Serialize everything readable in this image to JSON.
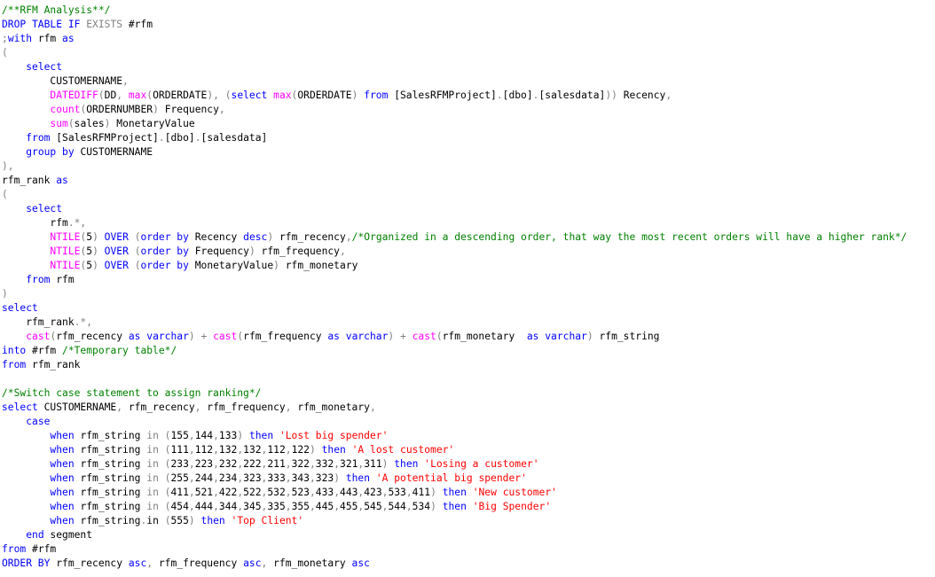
{
  "editor": {
    "language": "T-SQL",
    "colors": {
      "keyword": "#0000ff",
      "function": "#ff00ff",
      "comment": "#008000",
      "string": "#ff0000",
      "operator": "#808080",
      "text": "#000000"
    },
    "lines": [
      [
        [
          "c",
          "/**RFM Analysis**/"
        ]
      ],
      [
        [
          "k",
          "DROP TABLE IF "
        ],
        [
          "o",
          "EXISTS"
        ],
        [
          "t",
          " #rfm"
        ]
      ],
      [
        [
          "o",
          ";"
        ],
        [
          "k",
          "with"
        ],
        [
          "t",
          " rfm "
        ],
        [
          "k",
          "as"
        ]
      ],
      [
        [
          "o",
          "("
        ]
      ],
      [
        [
          "t",
          "    "
        ],
        [
          "k",
          "select"
        ]
      ],
      [
        [
          "t",
          "        CUSTOMERNAME"
        ],
        [
          "o",
          ","
        ]
      ],
      [
        [
          "t",
          "        "
        ],
        [
          "f",
          "DATEDIFF"
        ],
        [
          "o",
          "("
        ],
        [
          "t",
          "DD"
        ],
        [
          "o",
          ", "
        ],
        [
          "f",
          "max"
        ],
        [
          "o",
          "("
        ],
        [
          "t",
          "ORDERDATE"
        ],
        [
          "o",
          "), ("
        ],
        [
          "k",
          "select "
        ],
        [
          "f",
          "max"
        ],
        [
          "o",
          "("
        ],
        [
          "t",
          "ORDERDATE"
        ],
        [
          "o",
          ") "
        ],
        [
          "k",
          "from"
        ],
        [
          "t",
          " [SalesRFMProject]"
        ],
        [
          "o",
          "."
        ],
        [
          "t",
          "[dbo]"
        ],
        [
          "o",
          "."
        ],
        [
          "t",
          "[salesdata]"
        ],
        [
          "o",
          "))"
        ],
        [
          "t",
          " Recency"
        ],
        [
          "o",
          ","
        ]
      ],
      [
        [
          "t",
          "        "
        ],
        [
          "f",
          "count"
        ],
        [
          "o",
          "("
        ],
        [
          "t",
          "ORDERNUMBER"
        ],
        [
          "o",
          ")"
        ],
        [
          "t",
          " Frequency"
        ],
        [
          "o",
          ","
        ]
      ],
      [
        [
          "t",
          "        "
        ],
        [
          "f",
          "sum"
        ],
        [
          "o",
          "("
        ],
        [
          "t",
          "sales"
        ],
        [
          "o",
          ")"
        ],
        [
          "t",
          " MonetaryValue"
        ]
      ],
      [
        [
          "t",
          "    "
        ],
        [
          "k",
          "from"
        ],
        [
          "t",
          " [SalesRFMProject]"
        ],
        [
          "o",
          "."
        ],
        [
          "t",
          "[dbo]"
        ],
        [
          "o",
          "."
        ],
        [
          "t",
          "[salesdata]"
        ]
      ],
      [
        [
          "t",
          "    "
        ],
        [
          "k",
          "group by"
        ],
        [
          "t",
          " CUSTOMERNAME"
        ]
      ],
      [
        [
          "o",
          "),"
        ]
      ],
      [
        [
          "t",
          "rfm_rank "
        ],
        [
          "k",
          "as"
        ]
      ],
      [
        [
          "o",
          "("
        ]
      ],
      [
        [
          "t",
          "    "
        ],
        [
          "k",
          "select"
        ]
      ],
      [
        [
          "t",
          "        rfm"
        ],
        [
          "o",
          ".*,"
        ]
      ],
      [
        [
          "t",
          "        "
        ],
        [
          "f",
          "NTILE"
        ],
        [
          "o",
          "("
        ],
        [
          "t",
          "5"
        ],
        [
          "o",
          ") "
        ],
        [
          "k",
          "OVER"
        ],
        [
          "o",
          " ("
        ],
        [
          "k",
          "order by"
        ],
        [
          "t",
          " Recency "
        ],
        [
          "k",
          "desc"
        ],
        [
          "o",
          ")"
        ],
        [
          "t",
          " rfm_recency"
        ],
        [
          "o",
          ","
        ],
        [
          "c",
          "/*Organized in a descending order, that way the most recent orders will have a higher rank*/"
        ]
      ],
      [
        [
          "t",
          "        "
        ],
        [
          "f",
          "NTILE"
        ],
        [
          "o",
          "("
        ],
        [
          "t",
          "5"
        ],
        [
          "o",
          ") "
        ],
        [
          "k",
          "OVER"
        ],
        [
          "o",
          " ("
        ],
        [
          "k",
          "order by"
        ],
        [
          "t",
          " Frequency"
        ],
        [
          "o",
          ")"
        ],
        [
          "t",
          " rfm_frequency"
        ],
        [
          "o",
          ","
        ]
      ],
      [
        [
          "t",
          "        "
        ],
        [
          "f",
          "NTILE"
        ],
        [
          "o",
          "("
        ],
        [
          "t",
          "5"
        ],
        [
          "o",
          ") "
        ],
        [
          "k",
          "OVER"
        ],
        [
          "o",
          " ("
        ],
        [
          "k",
          "order by"
        ],
        [
          "t",
          " MonetaryValue"
        ],
        [
          "o",
          ")"
        ],
        [
          "t",
          " rfm_monetary"
        ]
      ],
      [
        [
          "t",
          "    "
        ],
        [
          "k",
          "from"
        ],
        [
          "t",
          " rfm"
        ]
      ],
      [
        [
          "o",
          ")"
        ]
      ],
      [
        [
          "k",
          "select"
        ]
      ],
      [
        [
          "t",
          "    rfm_rank"
        ],
        [
          "o",
          ".*,"
        ]
      ],
      [
        [
          "t",
          "    "
        ],
        [
          "f",
          "cast"
        ],
        [
          "o",
          "("
        ],
        [
          "t",
          "rfm_recency "
        ],
        [
          "k",
          "as varchar"
        ],
        [
          "o",
          ") + "
        ],
        [
          "f",
          "cast"
        ],
        [
          "o",
          "("
        ],
        [
          "t",
          "rfm_frequency "
        ],
        [
          "k",
          "as varchar"
        ],
        [
          "o",
          ") + "
        ],
        [
          "f",
          "cast"
        ],
        [
          "o",
          "("
        ],
        [
          "t",
          "rfm_monetary  "
        ],
        [
          "k",
          "as varchar"
        ],
        [
          "o",
          ")"
        ],
        [
          "t",
          " rfm_string"
        ]
      ],
      [
        [
          "k",
          "into"
        ],
        [
          "t",
          " #rfm "
        ],
        [
          "c",
          "/*Temporary table*/"
        ]
      ],
      [
        [
          "k",
          "from"
        ],
        [
          "t",
          " rfm_rank"
        ]
      ],
      [],
      [
        [
          "c",
          "/*Switch case statement to assign ranking*/"
        ]
      ],
      [
        [
          "k",
          "select"
        ],
        [
          "t",
          " CUSTOMERNAME"
        ],
        [
          "o",
          ","
        ],
        [
          "t",
          " rfm_recency"
        ],
        [
          "o",
          ","
        ],
        [
          "t",
          " rfm_frequency"
        ],
        [
          "o",
          ","
        ],
        [
          "t",
          " rfm_monetary"
        ],
        [
          "o",
          ","
        ]
      ],
      [
        [
          "t",
          "    "
        ],
        [
          "k",
          "case"
        ]
      ],
      [
        [
          "t",
          "        "
        ],
        [
          "k",
          "when"
        ],
        [
          "t",
          " rfm_string "
        ],
        [
          "o",
          "in ("
        ],
        [
          "t",
          "155"
        ],
        [
          "o",
          ","
        ],
        [
          "t",
          "144"
        ],
        [
          "o",
          ","
        ],
        [
          "t",
          "133"
        ],
        [
          "o",
          ") "
        ],
        [
          "k",
          "then "
        ],
        [
          "s",
          "'Lost big spender'"
        ]
      ],
      [
        [
          "t",
          "        "
        ],
        [
          "k",
          "when"
        ],
        [
          "t",
          " rfm_string "
        ],
        [
          "o",
          "in ("
        ],
        [
          "t",
          "111"
        ],
        [
          "o",
          ","
        ],
        [
          "t",
          "112"
        ],
        [
          "o",
          ","
        ],
        [
          "t",
          "132"
        ],
        [
          "o",
          ","
        ],
        [
          "t",
          "132"
        ],
        [
          "o",
          ","
        ],
        [
          "t",
          "112"
        ],
        [
          "o",
          ","
        ],
        [
          "t",
          "122"
        ],
        [
          "o",
          ") "
        ],
        [
          "k",
          "then "
        ],
        [
          "s",
          "'A lost customer'"
        ]
      ],
      [
        [
          "t",
          "        "
        ],
        [
          "k",
          "when"
        ],
        [
          "t",
          " rfm_string "
        ],
        [
          "o",
          "in ("
        ],
        [
          "t",
          "233"
        ],
        [
          "o",
          ","
        ],
        [
          "t",
          "223"
        ],
        [
          "o",
          ","
        ],
        [
          "t",
          "232"
        ],
        [
          "o",
          ","
        ],
        [
          "t",
          "222"
        ],
        [
          "o",
          ","
        ],
        [
          "t",
          "211"
        ],
        [
          "o",
          ","
        ],
        [
          "t",
          "322"
        ],
        [
          "o",
          ","
        ],
        [
          "t",
          "332"
        ],
        [
          "o",
          ","
        ],
        [
          "t",
          "321"
        ],
        [
          "o",
          ","
        ],
        [
          "t",
          "311"
        ],
        [
          "o",
          ") "
        ],
        [
          "k",
          "then "
        ],
        [
          "s",
          "'Losing a customer'"
        ]
      ],
      [
        [
          "t",
          "        "
        ],
        [
          "k",
          "when"
        ],
        [
          "t",
          " rfm_string "
        ],
        [
          "o",
          "in ("
        ],
        [
          "t",
          "255"
        ],
        [
          "o",
          ","
        ],
        [
          "t",
          "244"
        ],
        [
          "o",
          ","
        ],
        [
          "t",
          "234"
        ],
        [
          "o",
          ","
        ],
        [
          "t",
          "323"
        ],
        [
          "o",
          ","
        ],
        [
          "t",
          "333"
        ],
        [
          "o",
          ","
        ],
        [
          "t",
          "343"
        ],
        [
          "o",
          ","
        ],
        [
          "t",
          "323"
        ],
        [
          "o",
          ") "
        ],
        [
          "k",
          "then "
        ],
        [
          "s",
          "'A potential big spender'"
        ]
      ],
      [
        [
          "t",
          "        "
        ],
        [
          "k",
          "when"
        ],
        [
          "t",
          " rfm_string "
        ],
        [
          "o",
          "in ("
        ],
        [
          "t",
          "411"
        ],
        [
          "o",
          ","
        ],
        [
          "t",
          "521"
        ],
        [
          "o",
          ","
        ],
        [
          "t",
          "422"
        ],
        [
          "o",
          ","
        ],
        [
          "t",
          "522"
        ],
        [
          "o",
          ","
        ],
        [
          "t",
          "532"
        ],
        [
          "o",
          ","
        ],
        [
          "t",
          "523"
        ],
        [
          "o",
          ","
        ],
        [
          "t",
          "433"
        ],
        [
          "o",
          ","
        ],
        [
          "t",
          "443"
        ],
        [
          "o",
          ","
        ],
        [
          "t",
          "423"
        ],
        [
          "o",
          ","
        ],
        [
          "t",
          "533"
        ],
        [
          "o",
          ","
        ],
        [
          "t",
          "411"
        ],
        [
          "o",
          ") "
        ],
        [
          "k",
          "then "
        ],
        [
          "s",
          "'New customer'"
        ]
      ],
      [
        [
          "t",
          "        "
        ],
        [
          "k",
          "when"
        ],
        [
          "t",
          " rfm_string "
        ],
        [
          "o",
          "in ("
        ],
        [
          "t",
          "454"
        ],
        [
          "o",
          ","
        ],
        [
          "t",
          "444"
        ],
        [
          "o",
          ","
        ],
        [
          "t",
          "344"
        ],
        [
          "o",
          ","
        ],
        [
          "t",
          "345"
        ],
        [
          "o",
          ","
        ],
        [
          "t",
          "335"
        ],
        [
          "o",
          ","
        ],
        [
          "t",
          "355"
        ],
        [
          "o",
          ","
        ],
        [
          "t",
          "445"
        ],
        [
          "o",
          ","
        ],
        [
          "t",
          "455"
        ],
        [
          "o",
          ","
        ],
        [
          "t",
          "545"
        ],
        [
          "o",
          ","
        ],
        [
          "t",
          "544"
        ],
        [
          "o",
          ","
        ],
        [
          "t",
          "534"
        ],
        [
          "o",
          ") "
        ],
        [
          "k",
          "then "
        ],
        [
          "s",
          "'Big Spender'"
        ]
      ],
      [
        [
          "t",
          "        "
        ],
        [
          "k",
          "when"
        ],
        [
          "t",
          " rfm_string"
        ],
        [
          "o",
          "."
        ],
        [
          "t",
          "in "
        ],
        [
          "o",
          "("
        ],
        [
          "t",
          "555"
        ],
        [
          "o",
          ") "
        ],
        [
          "k",
          "then "
        ],
        [
          "s",
          "'Top Client'"
        ]
      ],
      [
        [
          "t",
          "    "
        ],
        [
          "k",
          "end"
        ],
        [
          "t",
          " segment"
        ]
      ],
      [
        [
          "k",
          "from"
        ],
        [
          "t",
          " #rfm"
        ]
      ],
      [
        [
          "k",
          "ORDER BY"
        ],
        [
          "t",
          " rfm_recency "
        ],
        [
          "k",
          "asc"
        ],
        [
          "o",
          ","
        ],
        [
          "t",
          " rfm_frequency "
        ],
        [
          "k",
          "asc"
        ],
        [
          "o",
          ","
        ],
        [
          "t",
          " rfm_monetary "
        ],
        [
          "k",
          "asc"
        ]
      ]
    ]
  }
}
